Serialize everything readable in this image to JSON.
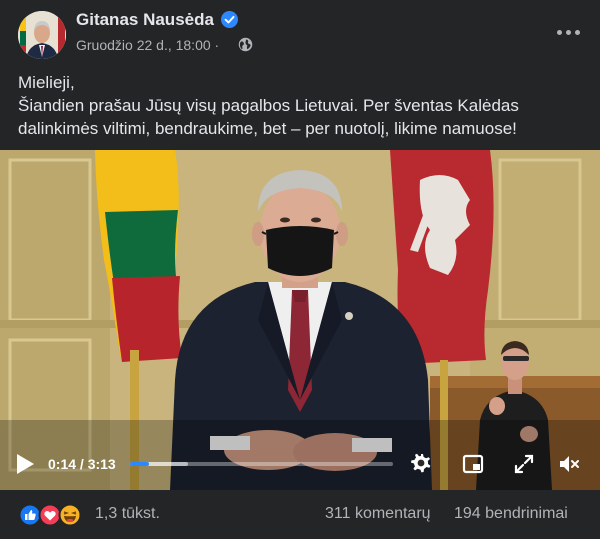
{
  "post": {
    "author": "Gitanas Nausėda",
    "date": "Gruodžio 22 d., 18:00",
    "meta_separator": "·",
    "message_lines": [
      "Mielieji,",
      "Šiandien prašau Jūsų visų pagalbos Lietuvai. Per šventas Kalėdas",
      "dalinkimės viltimi, bendraukime, bet – per nuotolį, likime namuose!"
    ]
  },
  "video": {
    "current_time": "0:14",
    "duration": "3:13",
    "time_display": "0:14 / 3:13",
    "progress": 0.072,
    "buffered": 0.22
  },
  "footer": {
    "reaction_count": "1,3 tūkst.",
    "comments": "311 komentarų",
    "shares": "194 bendrinimai"
  },
  "colors": {
    "background": "#242526",
    "text": "#e4e6eb",
    "secondary_text": "#b0b3b8",
    "accent": "#2d88ff",
    "like": "#1877f2",
    "love": "#f33e58",
    "haha": "#f7b125"
  },
  "icons": {
    "verified": "verified-badge-icon",
    "privacy": "globe-icon",
    "menu": "more-horizontal-icon",
    "play": "play-icon",
    "settings": "gear-icon",
    "pip": "picture-in-picture-icon",
    "fullscreen": "fullscreen-icon",
    "volume": "volume-muted-icon"
  }
}
